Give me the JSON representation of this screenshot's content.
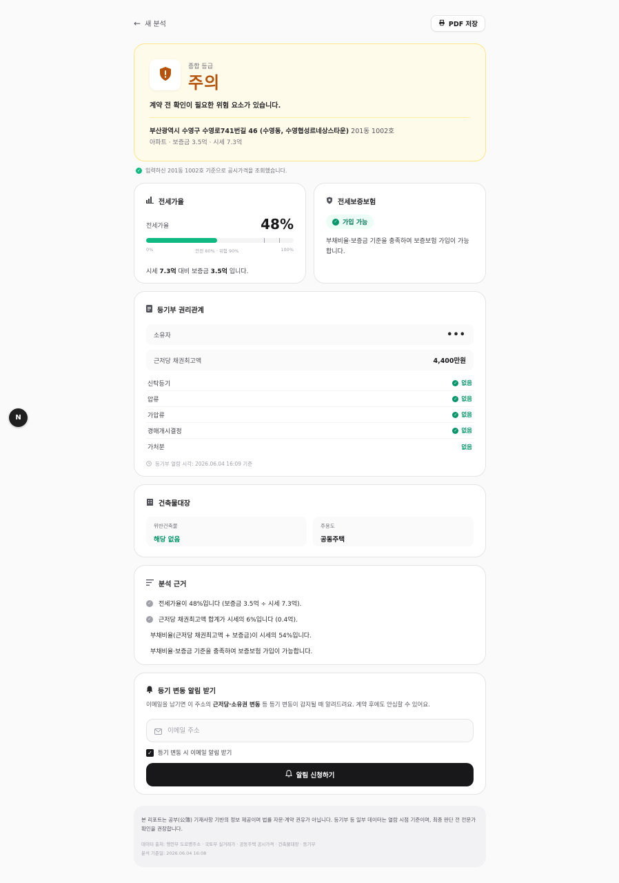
{
  "nav": {
    "back_label": "새 분석",
    "pdf_label": "PDF 저장"
  },
  "grade": {
    "label": "종합 등급",
    "value": "주의",
    "description": "계약 전 확인이 필요한 위험 요소가 있습니다.",
    "address": "부산광역시 수영구 수영로741번길 46 (수영동, 수영협성르네상스타운)",
    "unit": " 201동 1002호",
    "sub": "아파트 · 보증금 3.5억 · 시세 7.3억",
    "accent": "#b45309"
  },
  "lookup_note": "입력하신 201동 1002호 기준으로 공시가격을 조회했습니다.",
  "jeonse_ratio": {
    "title": "전세가율",
    "label": "전세가율",
    "value_text": "48%",
    "value": 48,
    "safe_mark": 80,
    "danger_mark": 90,
    "scale_min": "0%",
    "scale_mid": "안전 80% · 위험 90%",
    "scale_max": "100%",
    "foot_prefix": "시세 ",
    "foot_market": "7.3억",
    "foot_mid": " 대비 보증금 ",
    "foot_deposit": "3.5억",
    "foot_suffix": " 입니다."
  },
  "insurance": {
    "title": "전세보증보험",
    "badge": "가입 가능",
    "description": "부채비율·보증금 기준을 충족하여 보증보험 가입이 가능합니다."
  },
  "registry": {
    "title": "등기부 권리관계",
    "owner_label": "소유자",
    "owner_value": "•••",
    "mortgage_label": "근저당 채권최고액",
    "mortgage_value": "4,400만원",
    "rights": [
      {
        "label": "신탁등기",
        "value": "없음"
      },
      {
        "label": "압류",
        "value": "없음"
      },
      {
        "label": "가압류",
        "value": "없음"
      },
      {
        "label": "경매개시결정",
        "value": "없음"
      },
      {
        "label": "가처분",
        "value": "없음"
      }
    ],
    "time": "등기부 열람 시각: 2026.06.04 16:09 기준"
  },
  "building": {
    "title": "건축물대장",
    "violation_label": "위반건축물",
    "violation_value": "해당 없음",
    "use_label": "주용도",
    "use_value": "공동주택"
  },
  "basis": {
    "title": "분석 근거",
    "items": [
      "전세가율이 48%입니다 (보증금 3.5억 ÷ 시세 7.3억).",
      "근저당 채권최고액 합계가 시세의 6%입니다 (0.4억).",
      "부채비율(근저당 채권최고액 + 보증금)이 시세의 54%입니다.",
      "부채비율·보증금 기준을 충족하여 보증보험 가입이 가능합니다."
    ]
  },
  "alert": {
    "title": "등기 변동 알림 받기",
    "desc_prefix": "이메일을 남기면 이 주소의 ",
    "desc_bold": "근저당·소유권 변동",
    "desc_suffix": " 등 등기 변동이 감지될 때 알려드려요. 계약 후에도 안심할 수 있어요.",
    "email_placeholder": "이메일 주소",
    "checkbox_label": "등기 변동 시 이메일 알림 받기",
    "submit_label": "알림 신청하기"
  },
  "disclaimer": {
    "main": "본 리포트는 공부(公簿) 기재사항 기반의 정보 제공이며 법률 자문·계약 권유가 아닙니다. 등기부 등 일부 데이터는 열람 시점 기준이며, 최종 판단 전 전문가 확인을 권장합니다.",
    "sources": "데이터 출처: 행안부 도로명주소 · 국토부 실거래가 · 공동주택 공시가격 · 건축물대장 · 등기부",
    "date": "분석 기준일: 2026.06.04 16:08"
  },
  "devtools": {
    "badge": "N"
  }
}
